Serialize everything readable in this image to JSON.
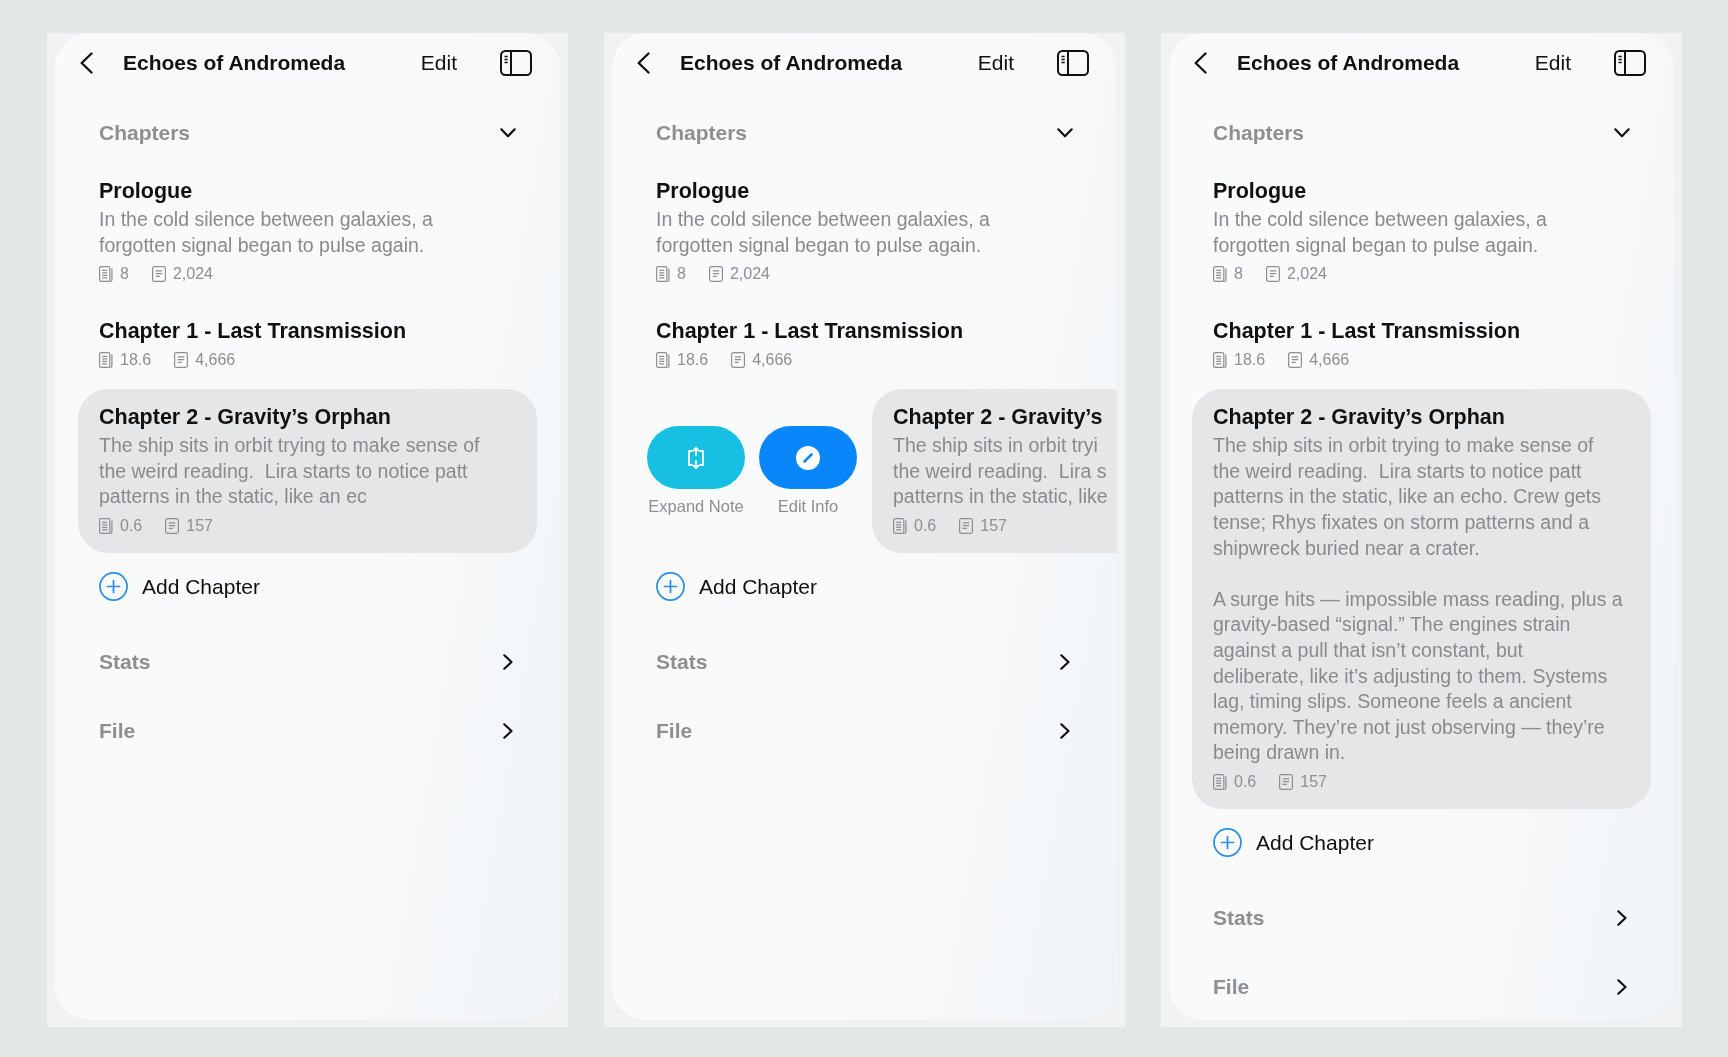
{
  "panels": [
    {
      "title": "Echoes of Andromeda",
      "edit": "Edit",
      "chapters_section": {
        "label": "Chapters",
        "expanded": true
      },
      "chapters": [
        {
          "title": "Prologue",
          "description": "In the cold silence between galaxies, a\nforgotten signal began to pulse again.",
          "pages": "8",
          "words": "2,024",
          "selected": false
        },
        {
          "title": "Chapter 1 - Last Transmission",
          "pages": "18.6",
          "words": "4,666",
          "selected": false
        },
        {
          "title": "Chapter 2 - Gravity’s Orphan",
          "description": "The ship sits in orbit trying to make sense of\nthe weird reading.  Lira starts to notice patt\npatterns in the static, like an ec",
          "pages": "0.6",
          "words": "157",
          "selected": true
        }
      ],
      "add_chapter": "Add Chapter",
      "sections": [
        {
          "label": "Stats",
          "expanded": false
        },
        {
          "label": "File",
          "expanded": false
        }
      ]
    },
    {
      "title": "Echoes of Andromeda",
      "edit": "Edit",
      "chapters_section": {
        "label": "Chapters",
        "expanded": true
      },
      "chapters": [
        {
          "title": "Prologue",
          "description": "In the cold silence between galaxies, a\nforgotten signal began to pulse again.",
          "pages": "8",
          "words": "2,024",
          "selected": false
        },
        {
          "title": "Chapter 1 - Last Transmission",
          "pages": "18.6",
          "words": "4,666",
          "selected": false
        },
        {
          "title": "Chapter 2 - Gravity’s",
          "description": "The ship sits in orbit tryi\nthe weird reading.  Lira s\npatterns in the static, like",
          "pages": "0.6",
          "words": "157",
          "selected": true,
          "actions": [
            {
              "kind": "expand",
              "label": "Expand Note",
              "color": "#17c0e3"
            },
            {
              "kind": "edit",
              "label": "Edit Info",
              "color": "#0a86fb"
            }
          ]
        }
      ],
      "add_chapter": "Add Chapter",
      "sections": [
        {
          "label": "Stats",
          "expanded": false
        },
        {
          "label": "File",
          "expanded": false
        }
      ]
    },
    {
      "title": "Echoes of Andromeda",
      "edit": "Edit",
      "chapters_section": {
        "label": "Chapters",
        "expanded": true
      },
      "chapters": [
        {
          "title": "Prologue",
          "description": "In the cold silence between galaxies, a\nforgotten signal began to pulse again.",
          "pages": "8",
          "words": "2,024",
          "selected": false
        },
        {
          "title": "Chapter 1 - Last Transmission",
          "pages": "18.6",
          "words": "4,666",
          "selected": false
        },
        {
          "title": "Chapter 2 - Gravity’s Orphan",
          "description": "The ship sits in orbit trying to make sense of\nthe weird reading.  Lira starts to notice patt\npatterns in the static, like an echo. Crew gets\ntense; Rhys fixates on storm patterns and a\nshipwreck buried near a crater.\n\nA surge hits — impossible mass reading, plus a\ngravity-based “signal.” The engines strain\nagainst a pull that isn’t constant, but\ndeliberate, like it’s adjusting to them. Systems\nlag, timing slips. Someone feels a ancient\nmemory. They’re not just observing — they’re\nbeing drawn in.",
          "pages": "0.6",
          "words": "157",
          "selected": true
        }
      ],
      "add_chapter": "Add Chapter",
      "sections": [
        {
          "label": "Stats",
          "expanded": false
        },
        {
          "label": "File",
          "expanded": false
        }
      ]
    }
  ]
}
